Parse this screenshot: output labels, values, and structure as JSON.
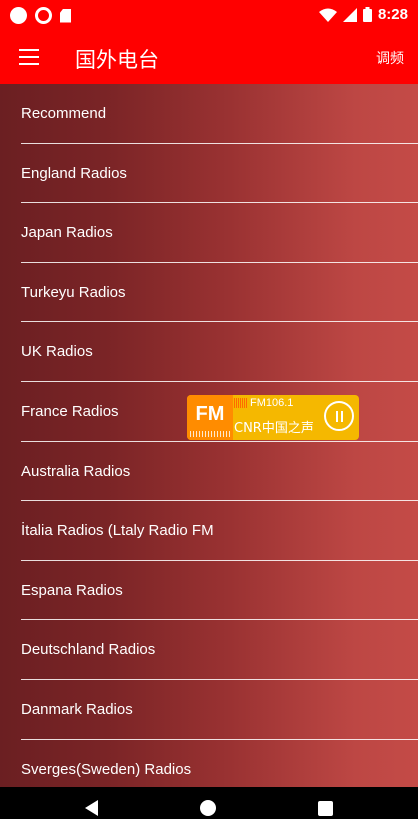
{
  "status_bar": {
    "time": "8:28",
    "icons": [
      "notification-dot-icon",
      "record-icon",
      "sd-card-icon",
      "wifi-icon",
      "signal-icon",
      "battery-icon"
    ]
  },
  "app_bar": {
    "title": "国外电台",
    "action_label": "调频",
    "background": "#ff0000"
  },
  "menu": {
    "items": [
      "Recommend",
      "England Radios",
      "Japan Radios",
      "Turkeyu Radios",
      "UK Radios",
      "France Radios",
      "Australia Radios",
      "İtalia Radios (Ltaly Radio FM",
      "Espana Radios",
      "Deutschland Radios",
      "Danmark Radios",
      "Sverges(Sweden) Radios"
    ]
  },
  "player": {
    "badge": "FM",
    "frequency": "FM106.1",
    "station": "CNR中国之声",
    "state": "playing",
    "accent": "#f5b800"
  },
  "nav_bar": {
    "icons": [
      "back-icon",
      "home-icon",
      "recents-icon"
    ]
  }
}
